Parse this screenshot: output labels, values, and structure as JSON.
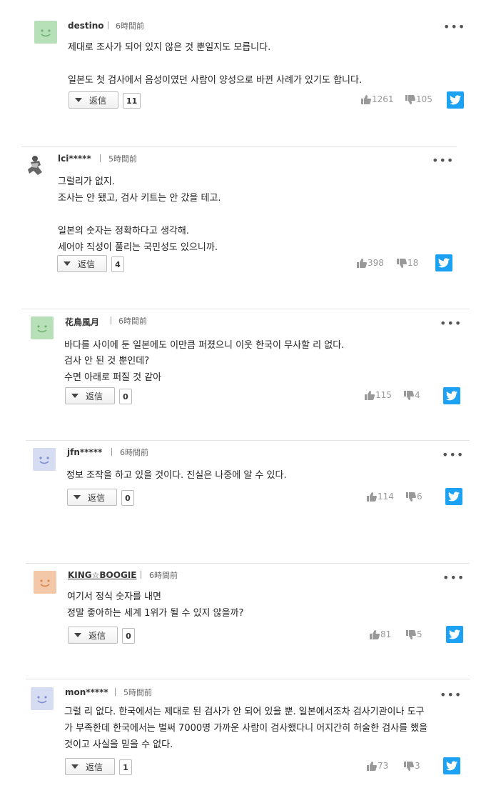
{
  "reply_label": "返信",
  "more_label": "•••",
  "comments": [
    {
      "name": "destino",
      "time": "6時間前",
      "avatar": "smiley-green",
      "lines": [
        "제대로 조사가 되어 있지 않은 것 뿐일지도 모릅니다.",
        "",
        "일본도 첫 검사에서 음성이였던 사람이 양성으로 바뀐 사례가 있기도 합니다."
      ],
      "replies": "11",
      "likes": "1261",
      "dislikes": "105"
    },
    {
      "name": "lci*****",
      "time": "5時間前",
      "avatar": "figure",
      "lines": [
        "그럴리가 없지.",
        "조사는 안 됐고, 검사 키트는 안 갔을 테고.",
        "",
        "일본의 숫자는 정확하다고 생각해.",
        "세어야 직성이 풀리는 국민성도 있으니까."
      ],
      "replies": "4",
      "likes": "398",
      "dislikes": "18"
    },
    {
      "name": "花鳥風月",
      "time": "6時間前",
      "avatar": "smiley-green",
      "lines": [
        "바다를 사이에 둔 일본에도 이만큼 퍼졌으니 이웃 한국이 무사할 리 없다.",
        "검사 안 된 것 뿐인데?",
        "수면 아래로 퍼질 것 같아"
      ],
      "replies": "0",
      "likes": "115",
      "dislikes": "4"
    },
    {
      "name": "jfn*****",
      "time": "6時間前",
      "avatar": "smiley-blue",
      "lines": [
        "정보 조작을 하고 있을 것이다. 진실은 나중에 알 수 있다."
      ],
      "replies": "0",
      "likes": "114",
      "dislikes": "6"
    },
    {
      "name": "KING☆BOOGIE",
      "time": "6時間前",
      "avatar": "smiley-orange",
      "lines": [
        "여기서 정식 숫자를 내면",
        "정말 좋아하는 세계 1위가 될 수 있지 않을까?"
      ],
      "replies": "0",
      "likes": "81",
      "dislikes": "5"
    },
    {
      "name": "mon*****",
      "time": "5時間前",
      "avatar": "smiley-blue",
      "lines": [
        "그럴 리 없다. 한국에서는 제대로 된 검사가 안 되어 있을 뿐. 일본에서조차 검사기관이나 도구",
        "가 부족한데 한국에서는 벌써 7000명 가까운 사람이 검사했다니 어지간히 허술한 검사를 했을",
        "것이고 사실을 믿을 수 없다."
      ],
      "replies": "1",
      "likes": "73",
      "dislikes": "3"
    }
  ],
  "colors": {
    "avatar_green": "#b8e0b8",
    "avatar_blue": "#d6dcf2",
    "avatar_orange": "#f2c8a8",
    "twitter": "#1da1f2",
    "vote_gray": "#999999"
  }
}
